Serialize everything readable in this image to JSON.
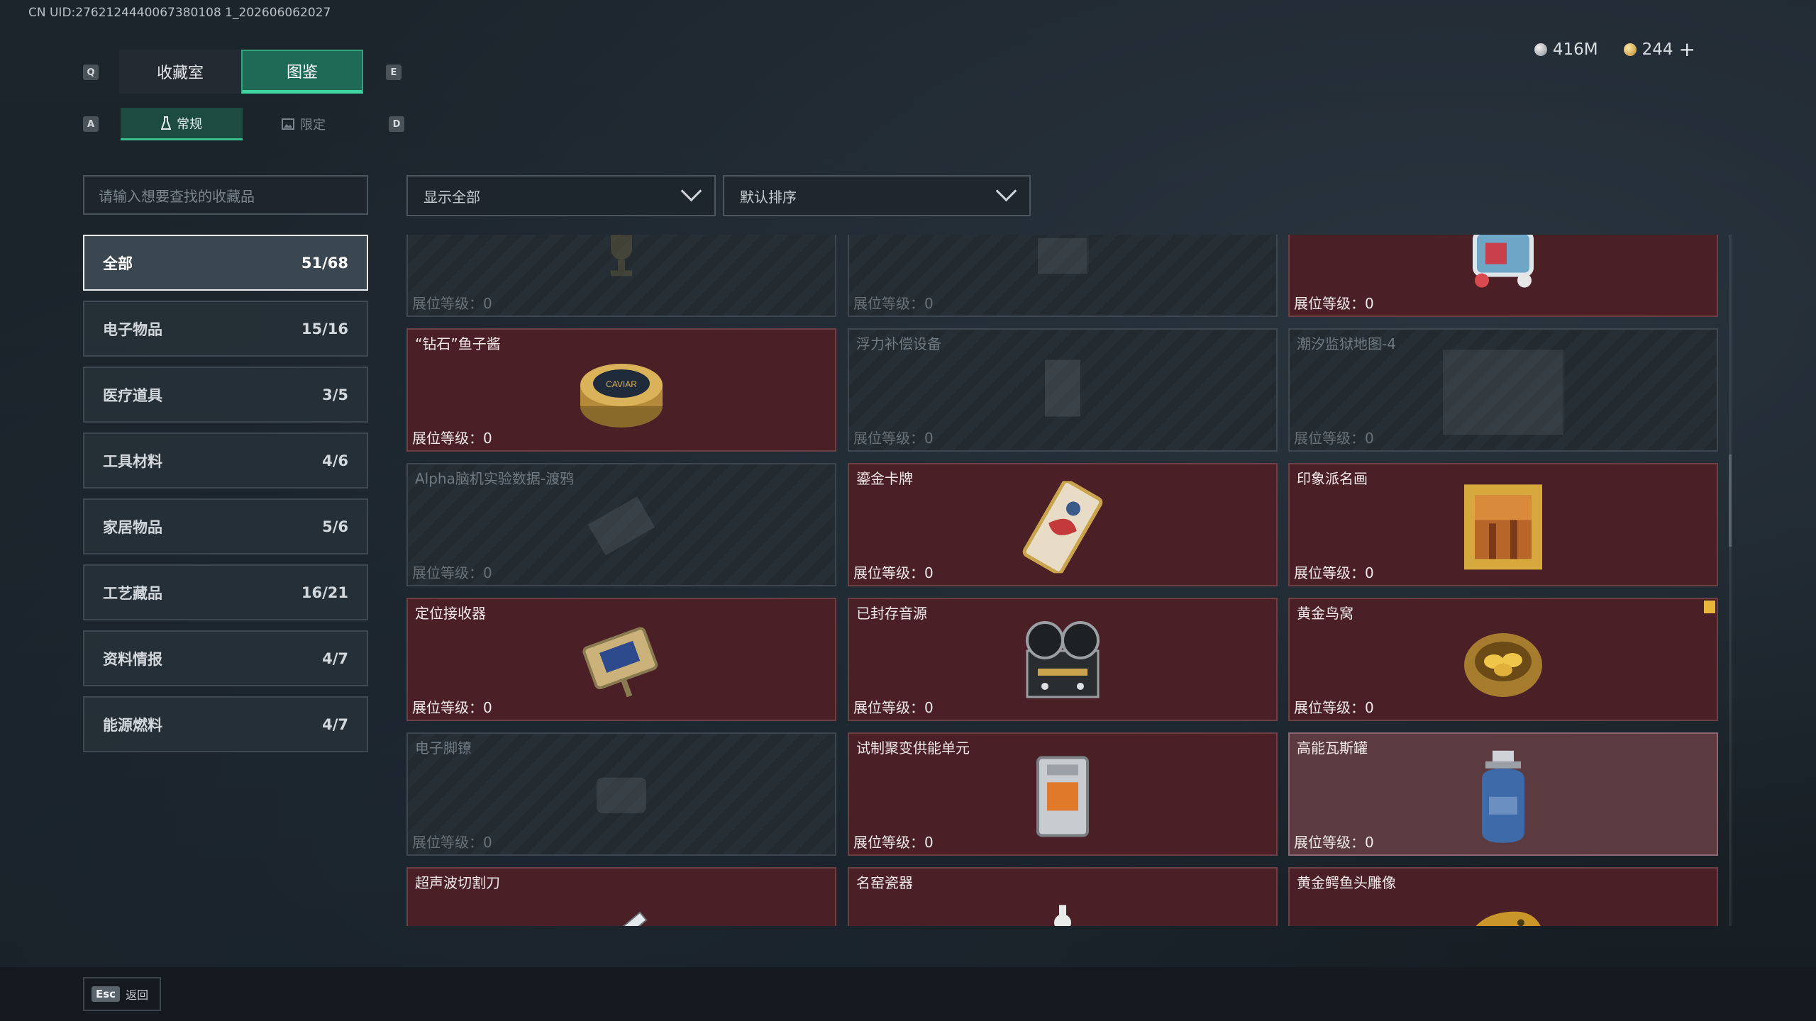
{
  "uid_text": "CN UID:2762124440067380108 1_202606062027",
  "keys": {
    "tab_left": "Q",
    "tab_right": "E",
    "sub_left": "A",
    "sub_right": "D"
  },
  "top_tabs": [
    {
      "label": "收藏室"
    },
    {
      "label": "图鉴"
    }
  ],
  "sub_tabs": [
    {
      "label": "常规"
    },
    {
      "label": "限定"
    }
  ],
  "currency": {
    "silver": "416M",
    "gold": "244",
    "plus": "+"
  },
  "search": {
    "placeholder": "请输入想要查找的收藏品"
  },
  "filters": {
    "show": "显示全部",
    "sort": "默认排序"
  },
  "categories": [
    {
      "label": "全部",
      "count": "51/68"
    },
    {
      "label": "电子物品",
      "count": "15/16"
    },
    {
      "label": "医疗道具",
      "count": "3/5"
    },
    {
      "label": "工具材料",
      "count": "4/6"
    },
    {
      "label": "家居物品",
      "count": "5/6"
    },
    {
      "label": "工艺藏品",
      "count": "16/21"
    },
    {
      "label": "资料情报",
      "count": "4/7"
    },
    {
      "label": "能源燃料",
      "count": "4/7"
    }
  ],
  "level_label": "展位等级：0",
  "cards": [
    {
      "name": "",
      "locked": true,
      "icon": "trophy-icon"
    },
    {
      "name": "",
      "locked": true,
      "icon": "crate-icon"
    },
    {
      "name": "",
      "locked": false,
      "icon": "toy-vehicle-icon"
    },
    {
      "name": "“钻石”鱼子酱",
      "locked": false,
      "icon": "caviar-tin-icon",
      "tin_text": "CAVIAR"
    },
    {
      "name": "浮力补偿设备",
      "locked": true,
      "icon": "buoyancy-device-icon"
    },
    {
      "name": "潮汐监狱地图-4",
      "locked": true,
      "icon": "map-icon"
    },
    {
      "name": "Alpha脑机实验数据-渡鸦",
      "locked": true,
      "icon": "data-drive-icon"
    },
    {
      "name": "鎏金卡牌",
      "locked": false,
      "icon": "gilded-card-icon"
    },
    {
      "name": "印象派名画",
      "locked": false,
      "icon": "framed-painting-icon"
    },
    {
      "name": "定位接收器",
      "locked": false,
      "icon": "locator-receiver-icon"
    },
    {
      "name": "已封存音源",
      "locked": false,
      "icon": "reel-recorder-icon"
    },
    {
      "name": "黄金鸟窝",
      "locked": false,
      "icon": "golden-nest-icon",
      "new": true
    },
    {
      "name": "电子脚镣",
      "locked": true,
      "icon": "ankle-monitor-icon"
    },
    {
      "name": "试制聚变供能单元",
      "locked": false,
      "icon": "fusion-cell-icon"
    },
    {
      "name": "高能瓦斯罐",
      "locked": false,
      "icon": "gas-canister-icon",
      "highlight": true
    },
    {
      "name": "超声波切割刀",
      "locked": false,
      "icon": "ultrasonic-knife-icon"
    },
    {
      "name": "名窑瓷器",
      "locked": false,
      "icon": "porcelain-icon"
    },
    {
      "name": "黄金鳄鱼头雕像",
      "locked": false,
      "icon": "gold-croc-head-icon"
    }
  ],
  "bottom": {
    "esc_key": "Esc",
    "esc_label": "返回"
  },
  "colors": {
    "accent": "#3fd3a0",
    "card_owned": "#4a1f26",
    "card_locked": "#232b31"
  }
}
